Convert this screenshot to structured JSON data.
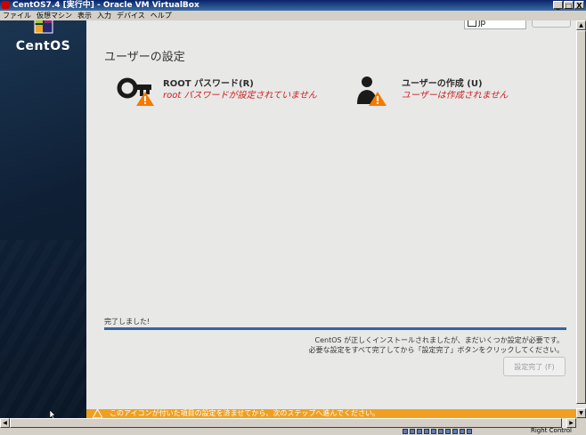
{
  "window": {
    "title": "CentOS7.4 [実行中] - Oracle VM VirtualBox",
    "minimize": "_",
    "restore": "□",
    "close": "X"
  },
  "menubar": {
    "items": [
      {
        "label": "ファイル"
      },
      {
        "label": "仮想マシン"
      },
      {
        "label": "表示"
      },
      {
        "label": "入力"
      },
      {
        "label": "デバイス"
      },
      {
        "label": "ヘルプ"
      }
    ]
  },
  "sidebar": {
    "logo_text": "CentOS"
  },
  "header": {
    "keyboard_layout": "jp"
  },
  "main": {
    "title": "ユーザーの設定",
    "spokes": [
      {
        "title": "ROOT パスワード(R)",
        "status": "root パスワードが設定されていません",
        "icon": "key-icon"
      },
      {
        "title": "ユーザーの作成 (U)",
        "status": "ユーザーは作成されません",
        "icon": "user-icon"
      }
    ]
  },
  "progress": {
    "label": "完了しました!",
    "fraction": 1.0,
    "color": "#3465a4"
  },
  "message": {
    "line1": "CentOS が正しくインストールされましたが、まだいくつか設定が必要です。",
    "line2": "必要な設定をすべて完了してから「設定完了」ボタンをクリックしてください。"
  },
  "buttons": {
    "finish_label": "設定完了 (F)"
  },
  "warning_bar": {
    "text": "このアイコンが付いた項目の設定を済ませてから、次のステップへ進んでください。",
    "color": "#f0a020"
  },
  "statusbar": {
    "host_key": "Right Control"
  },
  "colors": {
    "sidebar": "#0f2036",
    "status_red": "#cc1f1f",
    "warning_orange": "#f0a020"
  }
}
